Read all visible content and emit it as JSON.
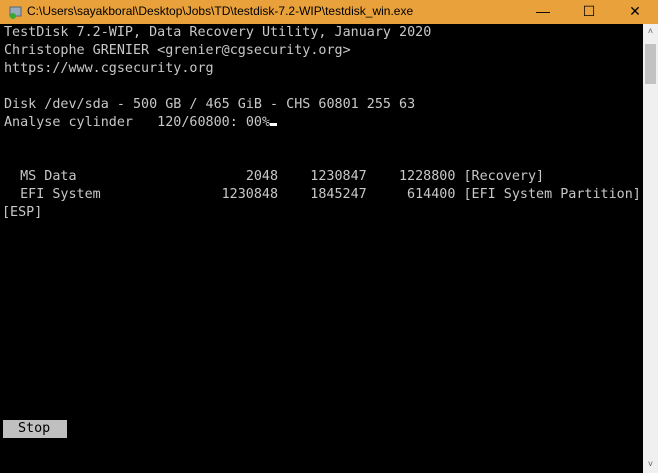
{
  "window": {
    "title": "C:\\Users\\sayakboral\\Desktop\\Jobs\\TD\\testdisk-7.2-WIP\\testdisk_win.exe",
    "minimize": "—",
    "maximize": "☐",
    "close": "✕"
  },
  "console": {
    "header": [
      "TestDisk 7.2-WIP, Data Recovery Utility, January 2020",
      "Christophe GRENIER <grenier@cgsecurity.org>",
      "https://www.cgsecurity.org"
    ],
    "disk": "Disk /dev/sda - 500 GB / 465 GiB - CHS 60801 255 63",
    "analyse": "Analyse cylinder   120/60800: 00%",
    "partitions": [
      {
        "type": "MS Data",
        "start": "2048",
        "end": "1230847",
        "size": "1228800",
        "label": "[Recovery]"
      },
      {
        "type": "EFI System",
        "start": "1230848",
        "end": "1845247",
        "size": "614400",
        "label": "[EFI System Partition]"
      }
    ],
    "wrap": "[ESP]",
    "stop_label": "Stop"
  },
  "scrollbar": {
    "up": "˄",
    "down": "˅"
  }
}
